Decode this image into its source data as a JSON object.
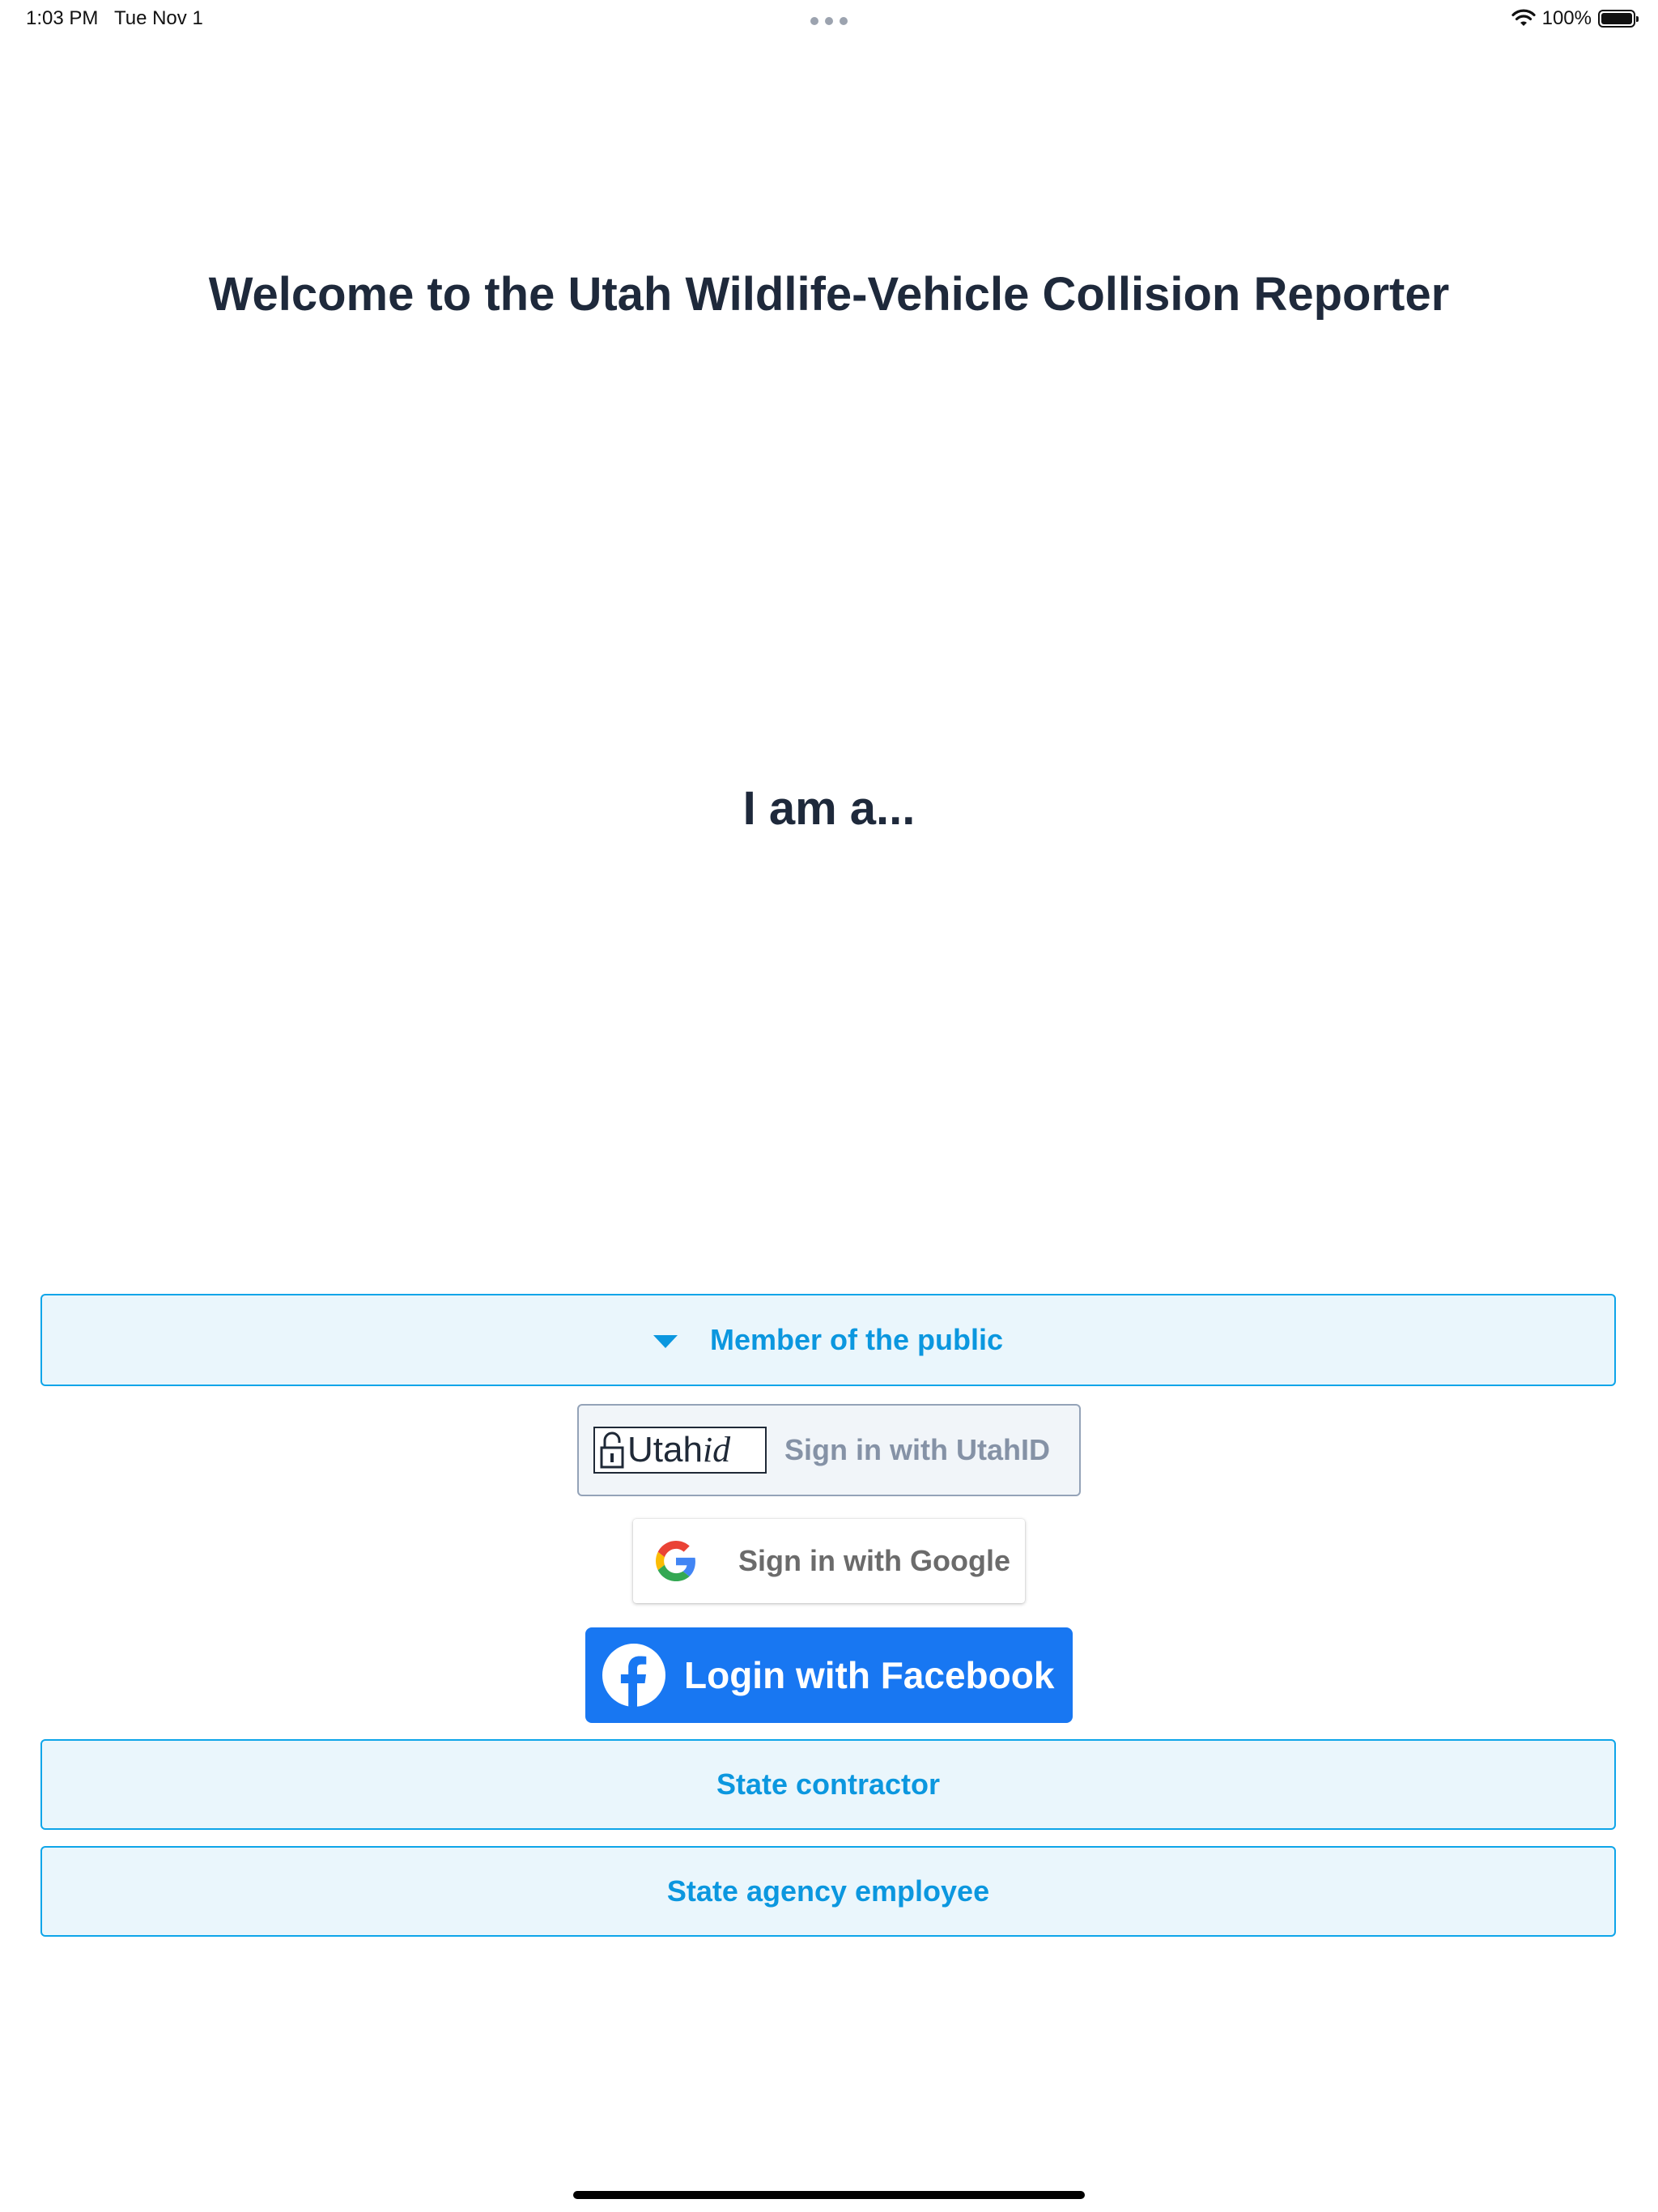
{
  "status_bar": {
    "time": "1:03 PM",
    "date": "Tue Nov 1",
    "battery_percent": "100%",
    "icons": [
      "more-dots-icon",
      "wifi-icon",
      "battery-icon"
    ]
  },
  "welcome": {
    "title": "Welcome to the Utah Wildlife-Vehicle Collision Reporter"
  },
  "role_prompt": {
    "heading": "I am a..."
  },
  "roles": {
    "public": {
      "label": "Member of the public",
      "expanded": true,
      "icon": "caret-down-icon"
    },
    "contractor": {
      "label": "State contractor"
    },
    "agency": {
      "label": "State agency employee"
    }
  },
  "sign_in": {
    "utahid": {
      "logo_text": "Utah",
      "logo_text_italic": "id",
      "label": "Sign in with UtahID",
      "icon": "padlock-icon"
    },
    "google": {
      "label": "Sign in with Google",
      "icon": "google-icon"
    },
    "facebook": {
      "label": "Login with Facebook",
      "icon": "facebook-icon"
    }
  },
  "colors": {
    "accent": "#0b97df",
    "role_background": "#eaf6fc",
    "heading": "#1e293b",
    "facebook": "#1877f2"
  }
}
